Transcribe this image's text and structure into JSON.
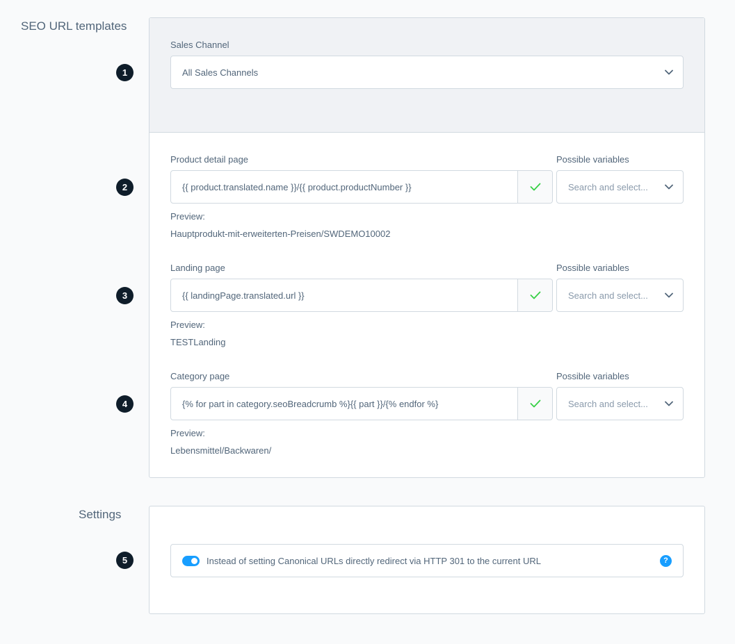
{
  "sections": {
    "seo_title": "SEO URL templates",
    "settings_title": "Settings"
  },
  "badges": [
    "1",
    "2",
    "3",
    "4",
    "5"
  ],
  "sales_channel": {
    "label": "Sales Channel",
    "value": "All Sales Channels"
  },
  "templates": [
    {
      "label": "Product detail page",
      "value": "{{ product.translated.name }}/{{ product.productNumber }}",
      "variables_label": "Possible variables",
      "variables_placeholder": "Search and select...",
      "preview_label": "Preview:",
      "preview_value": "Hauptprodukt-mit-erweiterten-Preisen/SWDEMO10002"
    },
    {
      "label": "Landing page",
      "value": "{{ landingPage.translated.url }}",
      "variables_label": "Possible variables",
      "variables_placeholder": "Search and select...",
      "preview_label": "Preview:",
      "preview_value": "TESTLanding"
    },
    {
      "label": "Category page",
      "value": "{% for part in category.seoBreadcrumb %}{{ part }}/{% endfor %}",
      "variables_label": "Possible variables",
      "variables_placeholder": "Search and select...",
      "preview_label": "Preview:",
      "preview_value": "Lebensmittel/Backwaren/"
    }
  ],
  "settings": {
    "redirect_label": "Instead of setting Canonical URLs directly redirect via HTTP 301 to the current URL",
    "redirect_enabled": true,
    "help_glyph": "?"
  },
  "colors": {
    "accent": "#189eff",
    "success": "#37d046",
    "badge": "#0f1d2a"
  }
}
